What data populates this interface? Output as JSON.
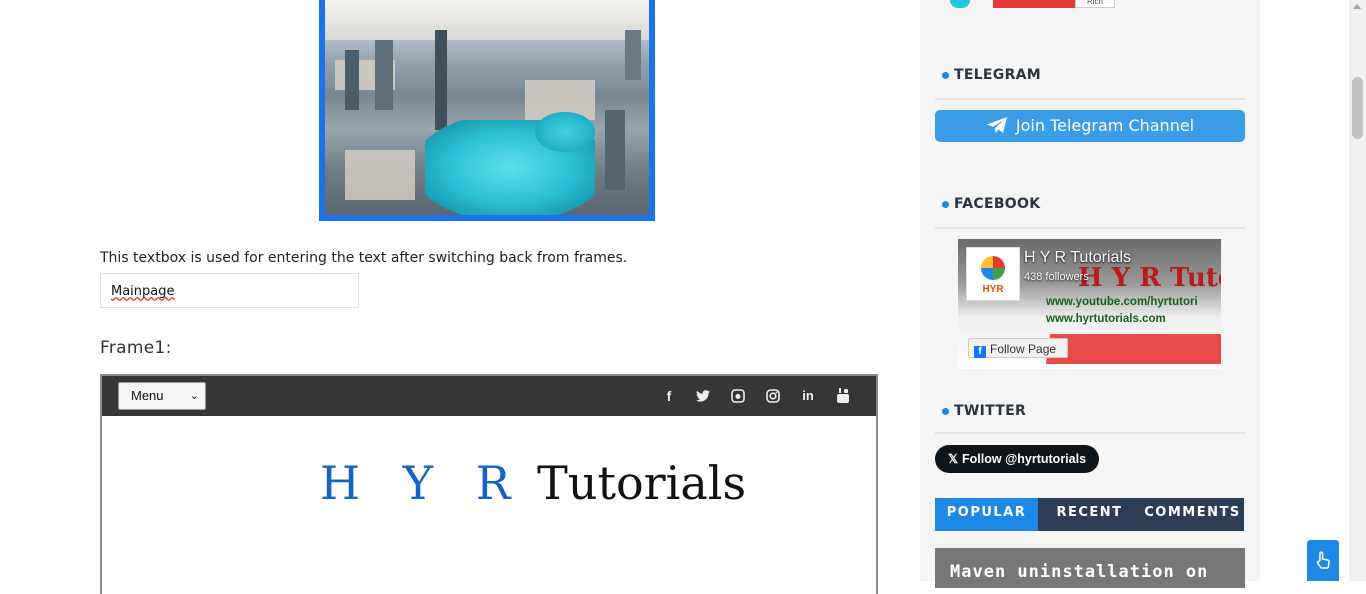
{
  "main": {
    "description": "This textbox is used for entering the text after switching back from frames.",
    "textbox_value": "Mainpage",
    "frame_label": "Frame1:"
  },
  "frame": {
    "menu_label": "Menu",
    "social_icons": [
      "facebook-icon",
      "twitter-icon",
      "github-icon",
      "instagram-icon",
      "linkedin-icon",
      "youtube-icon"
    ],
    "logo_hyr": "H Y R",
    "logo_tutorials": "Tutorials"
  },
  "sidebar": {
    "top_count": "Rich",
    "telegram_title": "TELEGRAM",
    "telegram_button": "Join Telegram Channel",
    "facebook_title": "FACEBOOK",
    "fb_page_name": "H Y R Tutorials",
    "fb_followers": "438 followers",
    "fb_banner_title": "H Y R Tutoria",
    "fb_banner_url1": "www.youtube.com/hyrtutori",
    "fb_banner_url2": "www.hyrtutorials.com",
    "fb_logo_text": "HYR",
    "fb_follow_button": "Follow Page",
    "twitter_title": "TWITTER",
    "x_follow_button": "Follow @hyrtutorials",
    "tabs": [
      {
        "label": "POPULAR",
        "active": true
      },
      {
        "label": "RECENT",
        "active": false
      },
      {
        "label": "COMMENTS",
        "active": false
      }
    ],
    "post_title": "Maven uninstallation on"
  },
  "colors": {
    "accent": "#1e88e5",
    "telegram": "#3b9ce8",
    "frame_bar": "#363636",
    "tabs_bg": "#2c3e55"
  }
}
